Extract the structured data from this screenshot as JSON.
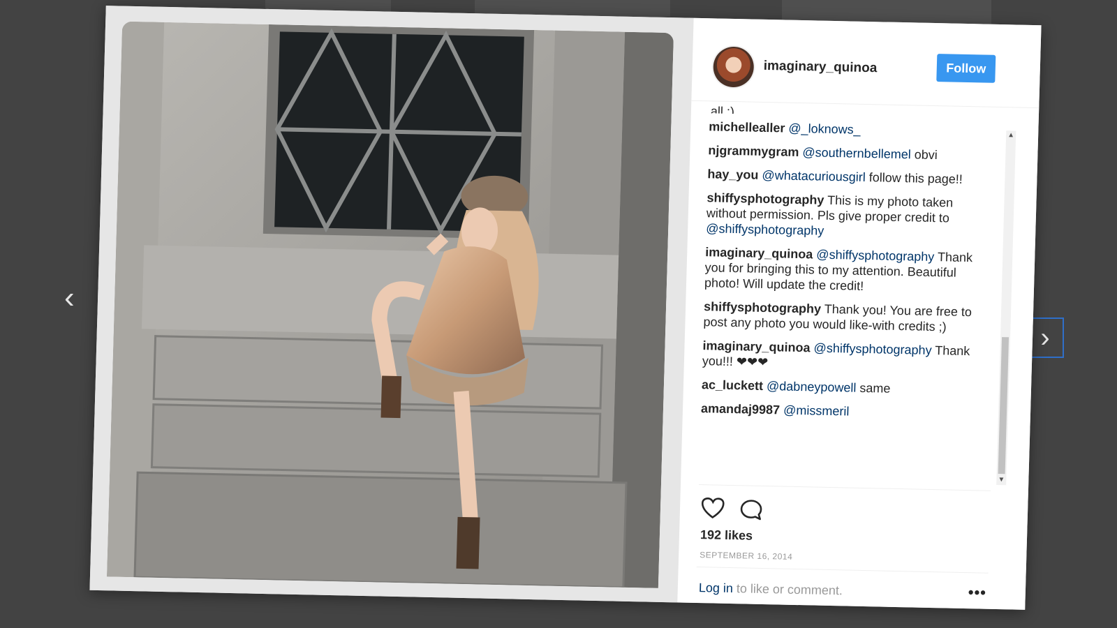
{
  "post": {
    "username": "imaginary_quinoa",
    "follow_label": "Follow",
    "truncated_comment": "all :)"
  },
  "comments": [
    {
      "user": "michellealler",
      "mention": "@_loknows_",
      "text": ""
    },
    {
      "user": "njgrammygram",
      "mention": "@southernbellemel",
      "text": " obvi"
    },
    {
      "user": "hay_you",
      "mention": "@whatacuriousgirl",
      "text": " follow this page!!"
    },
    {
      "user": "shiffysphotography",
      "mention": "",
      "text": " This is my photo taken without permission. Pls give proper credit to ",
      "mention_after": "@shiffysphotography"
    },
    {
      "user": "imaginary_quinoa",
      "mention": "@shiffysphotography",
      "text": " Thank you for bringing this to my attention. Beautiful photo! Will update the credit!"
    },
    {
      "user": "shiffysphotography",
      "mention": "",
      "text": " Thank you! You are free to post any photo you would like-with credits ;)"
    },
    {
      "user": "imaginary_quinoa",
      "mention": "@shiffysphotography",
      "text": " Thank you!!! ❤❤❤"
    },
    {
      "user": "ac_luckett",
      "mention": "@dabneypowell",
      "text": " same"
    },
    {
      "user": "amandaj9987",
      "mention": "@missmeril",
      "text": ""
    }
  ],
  "likes": "192 likes",
  "date": "SEPTEMBER 16, 2014",
  "login": {
    "link": "Log in",
    "rest": " to like or comment."
  },
  "icons": {
    "heart": "heart-icon",
    "comment": "comment-icon",
    "more": "more-icon",
    "prev": "chevron-left-icon",
    "next": "chevron-right-icon"
  },
  "colors": {
    "follow": "#3897f0",
    "mention": "#003569",
    "backdrop": "#434343"
  }
}
